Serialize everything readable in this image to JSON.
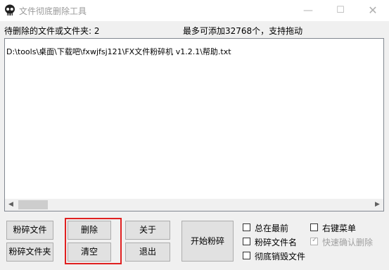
{
  "window": {
    "title": "文件彻底删除工具",
    "minimize": "—",
    "maximize": "☐",
    "close": "✕"
  },
  "status": {
    "pending": "待删除的文件或文件夹: 2",
    "limit": "最多可添加32768个，支持拖动"
  },
  "files": [
    "D:\\tools\\桌面\\下载吧\\fxwjfsj121\\FX文件粉碎机 v1.2.1\\帮助.txt"
  ],
  "buttons": {
    "shred_file": "粉碎文件",
    "shred_folder": "粉碎文件夹",
    "delete": "删除",
    "clear": "清空",
    "about": "关于",
    "exit": "退出",
    "start": "开始粉碎"
  },
  "options": {
    "always_on_top": "总在最前",
    "shred_filename": "粉碎文件名",
    "full_destroy": "彻底销毁文件",
    "context_menu": "右键菜单",
    "quick_confirm": "快速确认删除"
  },
  "colors": {
    "highlight_box": "#e02020"
  }
}
